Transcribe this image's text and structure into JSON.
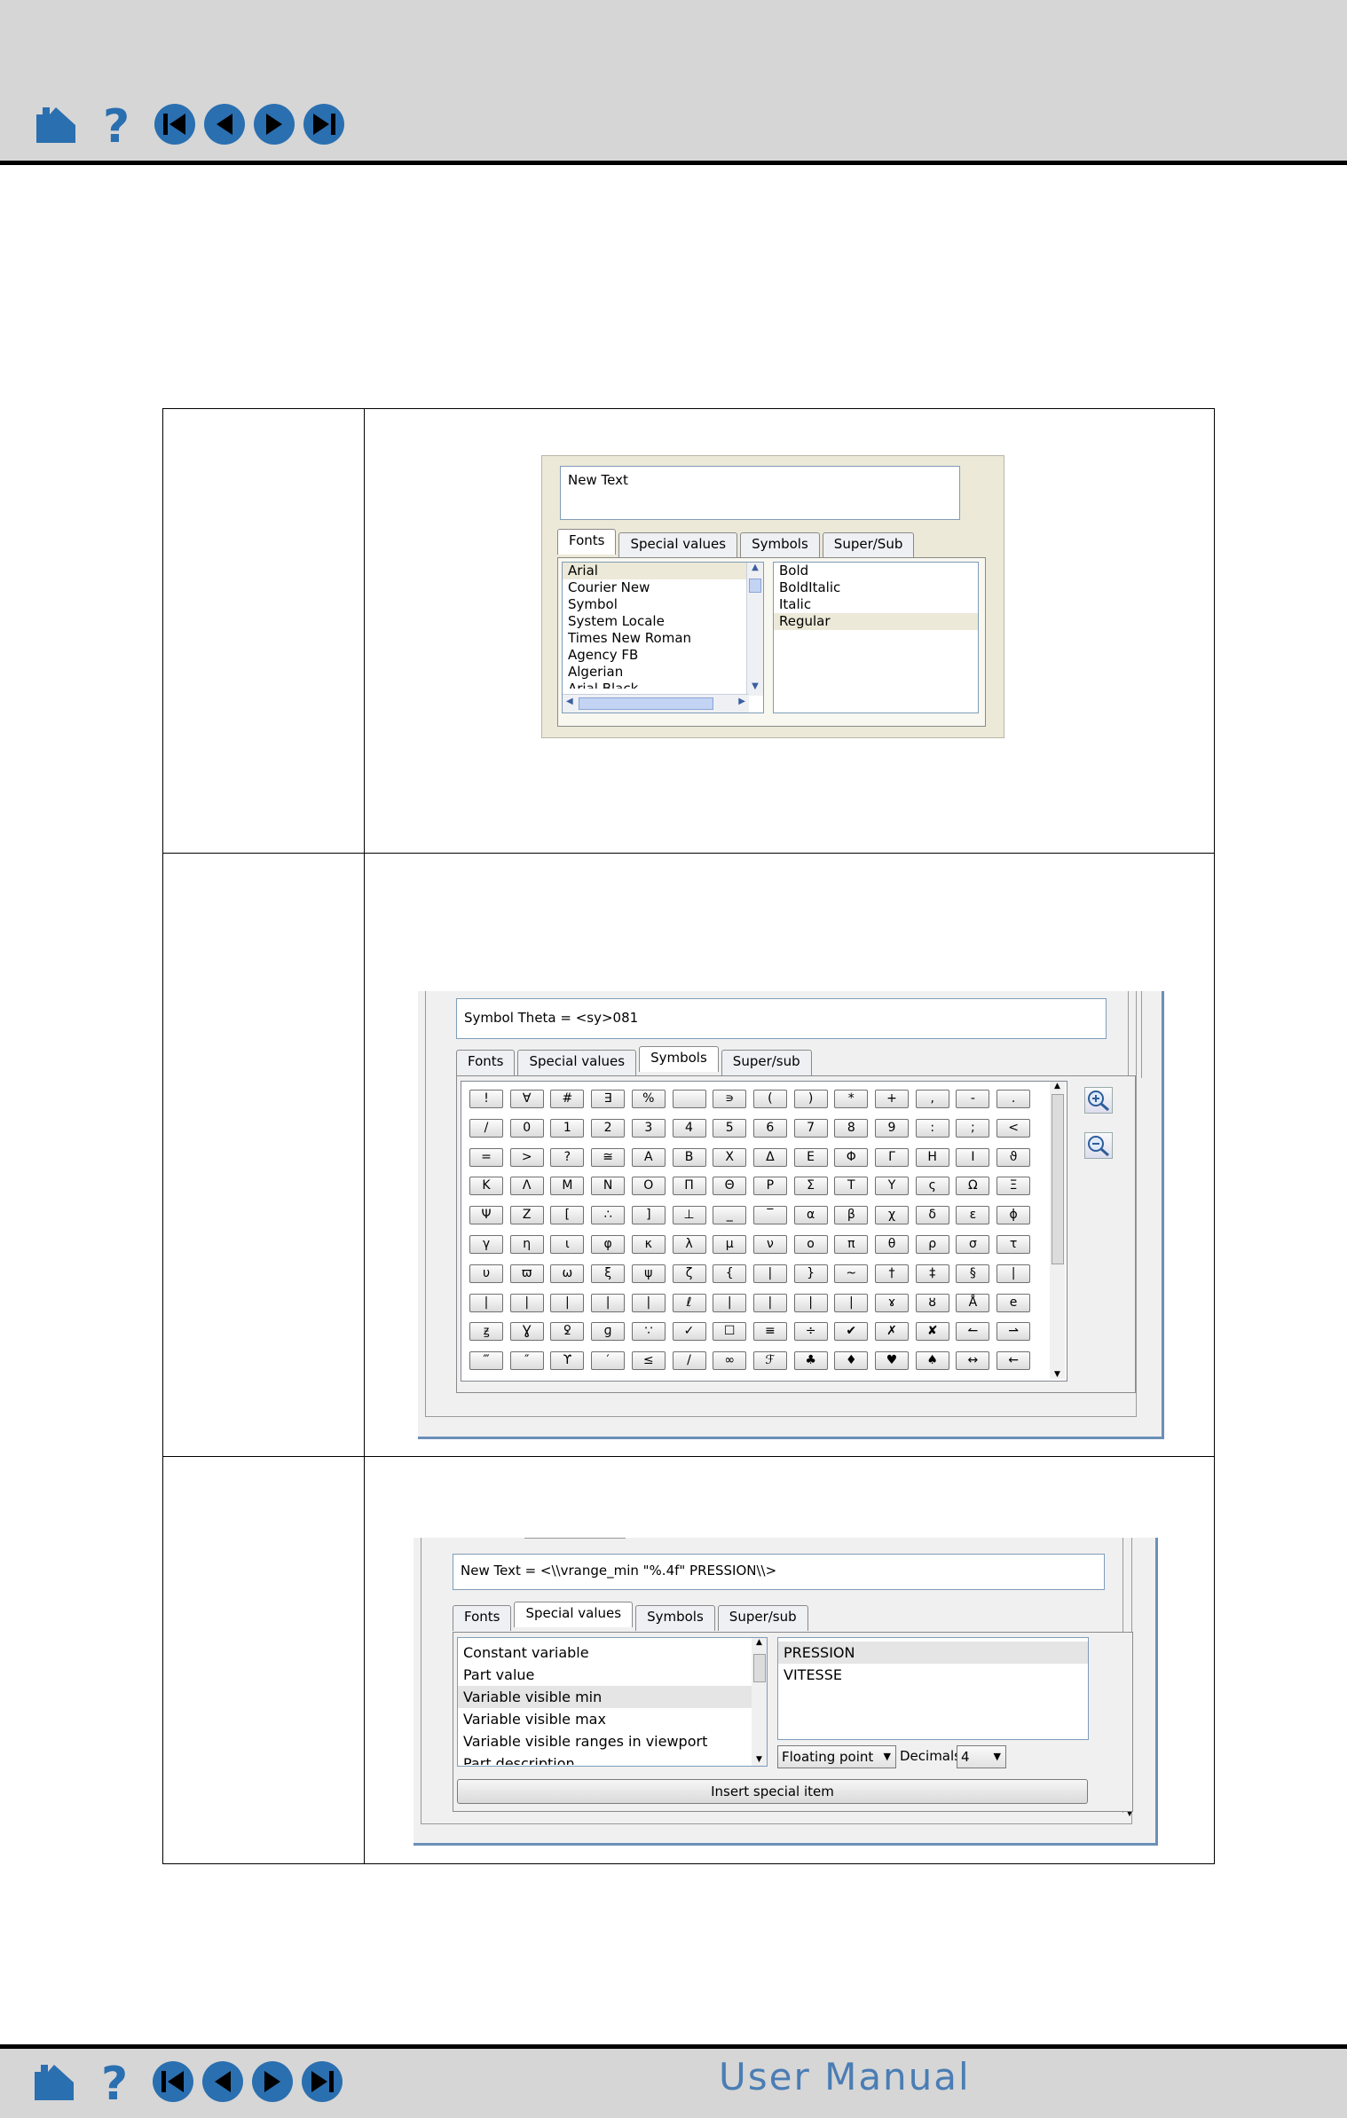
{
  "nav": {
    "icons": [
      "home-icon",
      "help-icon",
      "first-page-icon",
      "previous-page-icon",
      "next-page-icon",
      "last-page-icon"
    ],
    "accent_color": "#2a6fb0"
  },
  "footer": {
    "title": "User Manual"
  },
  "fonts_dialog": {
    "text_value": "New Text",
    "tabs": [
      "Fonts",
      "Special values",
      "Symbols",
      "Super/Sub"
    ],
    "active_tab": "Fonts",
    "font_list": [
      "Arial",
      "Courier New",
      "Symbol",
      "System Locale",
      "Times New Roman",
      "Agency FB",
      "Algerian",
      "Arial Black"
    ],
    "style_list": [
      "Bold",
      "BoldItalic",
      "Italic",
      "Regular"
    ]
  },
  "symbols_dialog": {
    "text_value": "Symbol Theta = <sy>081",
    "tabs": [
      "Fonts",
      "Special values",
      "Symbols",
      "Super/sub"
    ],
    "active_tab": "Symbols",
    "symbols": [
      [
        "!",
        "∀",
        "#",
        "∃",
        "%",
        "",
        "∍",
        "(",
        ")",
        "*",
        "+",
        ",",
        "-",
        "."
      ],
      [
        "/",
        "0",
        "1",
        "2",
        "3",
        "4",
        "5",
        "6",
        "7",
        "8",
        "9",
        ":",
        ";",
        "<"
      ],
      [
        "=",
        ">",
        "?",
        "≅",
        "Α",
        "Β",
        "Χ",
        "Δ",
        "Ε",
        "Φ",
        "Γ",
        "Η",
        "Ι",
        "ϑ"
      ],
      [
        "Κ",
        "Λ",
        "Μ",
        "Ν",
        "Ο",
        "Π",
        "Θ",
        "Ρ",
        "Σ",
        "Τ",
        "Υ",
        "ς",
        "Ω",
        "Ξ"
      ],
      [
        "Ψ",
        "Ζ",
        "[",
        "∴",
        "]",
        "⊥",
        "_",
        "‾",
        "α",
        "β",
        "χ",
        "δ",
        "ε",
        "ϕ"
      ],
      [
        "γ",
        "η",
        "ι",
        "φ",
        "κ",
        "λ",
        "μ",
        "ν",
        "ο",
        "π",
        "θ",
        "ρ",
        "σ",
        "τ"
      ],
      [
        "υ",
        "ϖ",
        "ω",
        "ξ",
        "ψ",
        "ζ",
        "{",
        "|",
        "}",
        "~",
        "†",
        "‡",
        "§",
        "|"
      ],
      [
        "|",
        "|",
        "|",
        "|",
        "|",
        "ℓ",
        "|",
        "|",
        "|",
        "|",
        "ɤ",
        "ȣ",
        "Å",
        "e"
      ],
      [
        "ꙃ",
        "Ɣ",
        "ꝿ",
        "ɡ",
        "∵",
        "✓",
        "☐",
        "≡",
        "÷",
        "✔",
        "✗",
        "✘",
        "↼",
        "⇀"
      ],
      [
        "‴",
        "″",
        "ϒ",
        "′",
        "≤",
        "/",
        "∞",
        "ℱ",
        "♣",
        "♦",
        "♥",
        "♠",
        "↔",
        "←"
      ]
    ],
    "zoom_in_icon": "zoom-in-icon",
    "zoom_out_icon": "zoom-out-icon"
  },
  "special_dialog": {
    "text_value": "New Text = <\\\\vrange_min \"%.4f\" PRESSION\\\\>",
    "tabs": [
      "Fonts",
      "Special values",
      "Symbols",
      "Super/sub"
    ],
    "active_tab": "Special values",
    "items": [
      "Constant variable",
      "Part value",
      "Variable visible min",
      "Variable visible max",
      "Variable visible ranges in viewport",
      "Part description"
    ],
    "selected_item": "Variable visible min",
    "variables": [
      "PRESSION",
      "VITESSE"
    ],
    "format_value": "Floating point",
    "decimals_label": "Decimals",
    "decimals_value": "4",
    "insert_button": "Insert special item"
  }
}
